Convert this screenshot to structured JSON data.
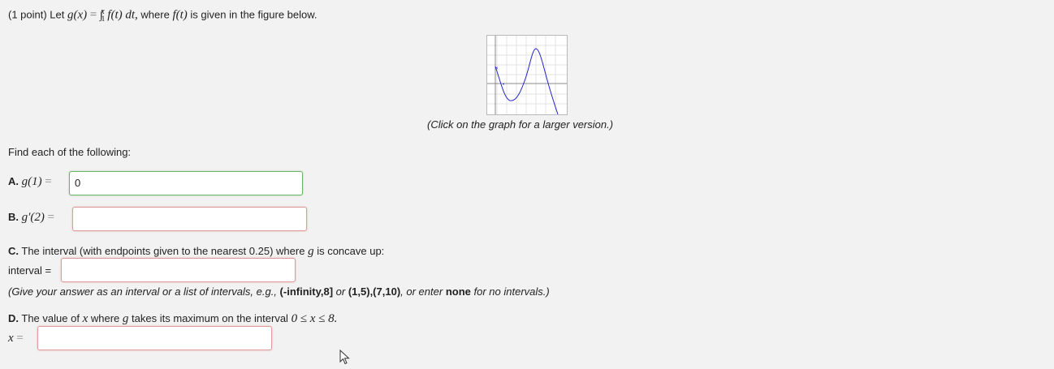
{
  "problem": {
    "points": "(1 point) Let",
    "fn_g": "g(x)",
    "equals": "=",
    "integral": "∫",
    "lower": "1",
    "upper": "x",
    "integrand": "f(t) dt,",
    "where_text": "where",
    "f_of_t": "f(t)",
    "given_text": "is given in the figure below."
  },
  "figure": {
    "caption": "(Click on the graph for a larger version.)",
    "curve_color": "#2222cc"
  },
  "instructions": "Find each of the following:",
  "part_a": {
    "letter": "A.",
    "expr": "g(1)",
    "equals": "=",
    "value": "0",
    "status": "correct"
  },
  "part_b": {
    "letter": "B.",
    "expr": "g′(2)",
    "equals": "=",
    "value": ""
  },
  "part_c": {
    "letter": "C.",
    "text": "The interval (with endpoints given to the nearest 0.25) where",
    "var": "g",
    "text2": "is concave up:",
    "label": "interval =",
    "value": "",
    "hint_pre": "(Give your answer as an interval or a list of intervals, e.g.,",
    "hint_ex1": "(-infinity,8]",
    "hint_or": "or",
    "hint_ex2": "(1,5),(7,10)",
    "hint_mid": ", or enter",
    "hint_none": "none",
    "hint_post": "for no intervals.)"
  },
  "part_d": {
    "letter": "D.",
    "text": "The value of",
    "var_x": "x",
    "text2": "where",
    "var_g": "g",
    "text3": "takes its maximum on the interval",
    "interval": "0 ≤ x ≤ 8.",
    "label": "x",
    "equals": "=",
    "value": ""
  }
}
